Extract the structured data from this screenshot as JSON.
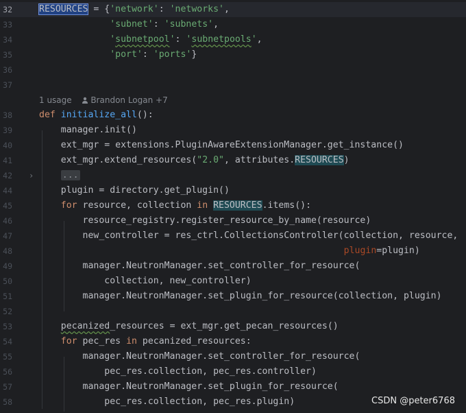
{
  "editor": {
    "lines": [
      {
        "num": "32",
        "current": true,
        "tokens": [
          {
            "t": "RESOURCES",
            "c": "sel"
          },
          {
            "t": " = {"
          },
          {
            "t": "'network'",
            "c": "str"
          },
          {
            "t": ": "
          },
          {
            "t": "'networks'",
            "c": "str"
          },
          {
            "t": ","
          }
        ]
      },
      {
        "num": "33",
        "tokens": [
          {
            "t": "             "
          },
          {
            "t": "'subnet'",
            "c": "str"
          },
          {
            "t": ": "
          },
          {
            "t": "'subnets'",
            "c": "str"
          },
          {
            "t": ","
          }
        ]
      },
      {
        "num": "34",
        "tokens": [
          {
            "t": "             "
          },
          {
            "t": "'",
            "c": "str"
          },
          {
            "t": "subnetpool",
            "c": "str typo"
          },
          {
            "t": "'",
            "c": "str"
          },
          {
            "t": ": "
          },
          {
            "t": "'",
            "c": "str"
          },
          {
            "t": "subnetpools",
            "c": "str typo"
          },
          {
            "t": "'",
            "c": "str"
          },
          {
            "t": ","
          }
        ]
      },
      {
        "num": "35",
        "tokens": [
          {
            "t": "             "
          },
          {
            "t": "'port'",
            "c": "str"
          },
          {
            "t": ": "
          },
          {
            "t": "'ports'",
            "c": "str"
          },
          {
            "t": "}"
          }
        ]
      },
      {
        "num": "36",
        "tokens": []
      },
      {
        "num": "37",
        "tokens": []
      },
      {
        "num": "38",
        "tokens": [
          {
            "t": "def ",
            "c": "kw"
          },
          {
            "t": "initialize_all",
            "c": "fn"
          },
          {
            "t": "():"
          }
        ]
      },
      {
        "num": "39",
        "tokens": [
          {
            "t": "    manager.init()"
          }
        ]
      },
      {
        "num": "40",
        "tokens": [
          {
            "t": "    ext_mgr = extensions.PluginAwareExtensionManager.get_instance()"
          }
        ]
      },
      {
        "num": "41",
        "tokens": [
          {
            "t": "    ext_mgr.extend_resources("
          },
          {
            "t": "\"2.0\"",
            "c": "str"
          },
          {
            "t": ", attributes."
          },
          {
            "t": "RESOURCES",
            "c": "hl"
          },
          {
            "t": ")"
          }
        ]
      },
      {
        "num": "42",
        "fold": "›",
        "tokens": [
          {
            "t": "    "
          },
          {
            "t": "...",
            "c": "collapsed"
          }
        ]
      },
      {
        "num": "44",
        "tokens": [
          {
            "t": "    plugin = directory.get_plugin()"
          }
        ]
      },
      {
        "num": "45",
        "tokens": [
          {
            "t": "    "
          },
          {
            "t": "for",
            "c": "kw"
          },
          {
            "t": " resource, collection "
          },
          {
            "t": "in",
            "c": "kw"
          },
          {
            "t": " "
          },
          {
            "t": "RESOURCES",
            "c": "hl"
          },
          {
            "t": ".items():"
          }
        ]
      },
      {
        "num": "46",
        "tokens": [
          {
            "t": "        resource_registry.register_resource_by_name(resource)"
          }
        ]
      },
      {
        "num": "47",
        "tokens": [
          {
            "t": "        new_controller = res_ctrl.CollectionsController(collection, resource,"
          }
        ]
      },
      {
        "num": "48",
        "tokens": [
          {
            "t": "                                                        "
          },
          {
            "t": "plugin",
            "c": "param"
          },
          {
            "t": "=plugin)"
          }
        ]
      },
      {
        "num": "49",
        "tokens": [
          {
            "t": "        manager.NeutronManager.set_controller_for_resource("
          }
        ]
      },
      {
        "num": "50",
        "tokens": [
          {
            "t": "            collection, new_controller)"
          }
        ]
      },
      {
        "num": "51",
        "tokens": [
          {
            "t": "        manager.NeutronManager.set_plugin_for_resource(collection, plugin)"
          }
        ]
      },
      {
        "num": "52",
        "tokens": []
      },
      {
        "num": "53",
        "tokens": [
          {
            "t": "    "
          },
          {
            "t": "pecanized",
            "c": "typo"
          },
          {
            "t": "_resources = ext_mgr.get_pecan_resources()"
          }
        ]
      },
      {
        "num": "54",
        "tokens": [
          {
            "t": "    "
          },
          {
            "t": "for",
            "c": "kw"
          },
          {
            "t": " pec_res "
          },
          {
            "t": "in",
            "c": "kw"
          },
          {
            "t": " pecanized_resources:"
          }
        ]
      },
      {
        "num": "55",
        "tokens": [
          {
            "t": "        manager.NeutronManager.set_controller_for_resource("
          }
        ]
      },
      {
        "num": "56",
        "tokens": [
          {
            "t": "            pec_res.collection, pec_res.controller)"
          }
        ]
      },
      {
        "num": "57",
        "tokens": [
          {
            "t": "        manager.NeutronManager.set_plugin_for_resource("
          }
        ]
      },
      {
        "num": "58",
        "tokens": [
          {
            "t": "            pec_res.collection, pec_res.plugin)"
          }
        ]
      }
    ],
    "usage_hint": {
      "usages": "1 usage",
      "authors": "Brandon Logan +7"
    }
  },
  "watermark": "CSDN @peter6768",
  "colors": {
    "background": "#1e1f22",
    "keyword": "#cf8e6d",
    "string": "#6aab73",
    "function": "#56a8f5",
    "named_param": "#aa4926",
    "selection": "#214283",
    "highlight": "#1f4a53"
  }
}
